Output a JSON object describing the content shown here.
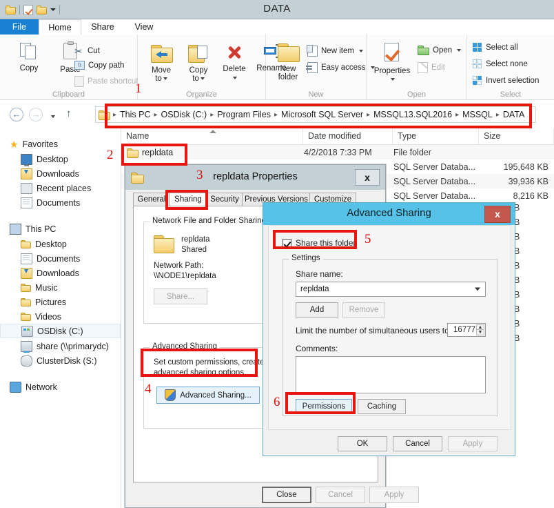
{
  "window": {
    "title": "DATA",
    "quick_access": [
      "folder-icon",
      "properties-icon",
      "folder-icon",
      "dropdown-caret"
    ]
  },
  "ribbon": {
    "tabs": [
      {
        "label": "File",
        "selected": false,
        "is_file": true
      },
      {
        "label": "Home",
        "selected": true,
        "is_file": false
      },
      {
        "label": "Share",
        "selected": false,
        "is_file": false
      },
      {
        "label": "View",
        "selected": false,
        "is_file": false
      }
    ],
    "groups": [
      {
        "name": "Clipboard",
        "big_buttons": [
          {
            "label": "Copy"
          },
          {
            "label": "Paste"
          }
        ],
        "small_buttons": [
          {
            "label": "Cut",
            "disabled": false
          },
          {
            "label": "Copy path",
            "disabled": false
          },
          {
            "label": "Paste shortcut",
            "disabled": true
          }
        ]
      },
      {
        "name": "Organize",
        "big_buttons": [
          {
            "label": "Move\nto"
          },
          {
            "label": "Copy\nto"
          },
          {
            "label": "Delete"
          },
          {
            "label": "Rename"
          }
        ],
        "small_buttons": []
      },
      {
        "name": "New",
        "big_buttons": [
          {
            "label": "New\nfolder"
          }
        ],
        "small_buttons": [
          {
            "label": "New item",
            "disabled": false
          },
          {
            "label": "Easy access",
            "disabled": false
          }
        ]
      },
      {
        "name": "Open",
        "big_buttons": [
          {
            "label": "Properties"
          }
        ],
        "small_buttons": [
          {
            "label": "Open",
            "disabled": false
          },
          {
            "label": "Edit",
            "disabled": true
          }
        ]
      },
      {
        "name": "Select",
        "big_buttons": [],
        "small_buttons": [
          {
            "label": "Select all",
            "disabled": false
          },
          {
            "label": "Select none",
            "disabled": false
          },
          {
            "label": "Invert selection",
            "disabled": false
          }
        ]
      }
    ],
    "labels": {
      "move_to": "Move",
      "move_to2": "to",
      "copy_to": "Copy",
      "copy_to2": "to",
      "delete": "Delete",
      "rename": "Rename",
      "new_folder1": "New",
      "new_folder2": "folder",
      "properties": "Properties",
      "copy": "Copy",
      "paste": "Paste"
    }
  },
  "address_bar": {
    "back_icon": "back-arrow-icon",
    "forward_icon": "forward-arrow-icon",
    "history_icon": "dropdown-caret-icon",
    "up_icon": "up-arrow-icon",
    "breadcrumbs": [
      "This PC",
      "OSDisk (C:)",
      "Program Files",
      "Microsoft SQL Server",
      "MSSQL13.SQL2016",
      "MSSQL",
      "DATA"
    ],
    "separator": "▸"
  },
  "nav_pane": {
    "sections": [
      {
        "header": {
          "label": "Favorites",
          "icon": "star-icon"
        },
        "items": [
          {
            "label": "Desktop",
            "icon": "monitor-icon"
          },
          {
            "label": "Downloads",
            "icon": "downloads-folder-icon"
          },
          {
            "label": "Recent places",
            "icon": "recent-places-icon"
          },
          {
            "label": "Documents",
            "icon": "documents-icon"
          }
        ]
      },
      {
        "header": {
          "label": "This PC",
          "icon": "computer-icon"
        },
        "items": [
          {
            "label": "Desktop",
            "icon": "desktop-folder-icon"
          },
          {
            "label": "Documents",
            "icon": "documents-icon"
          },
          {
            "label": "Downloads",
            "icon": "downloads-folder-icon"
          },
          {
            "label": "Music",
            "icon": "music-folder-icon"
          },
          {
            "label": "Pictures",
            "icon": "pictures-folder-icon"
          },
          {
            "label": "Videos",
            "icon": "videos-folder-icon"
          },
          {
            "label": "OSDisk (C:)",
            "icon": "hard-drive-icon",
            "selected": true
          },
          {
            "label": "share (\\\\primarydc)",
            "icon": "network-drive-icon"
          },
          {
            "label": "ClusterDisk (S:)",
            "icon": "disk-icon"
          }
        ]
      },
      {
        "header": {
          "label": "Network",
          "icon": "network-icon"
        },
        "items": []
      }
    ]
  },
  "file_list": {
    "columns": [
      {
        "label": "Name",
        "sorted": "asc"
      },
      {
        "label": "Date modified"
      },
      {
        "label": "Type"
      },
      {
        "label": "Size"
      }
    ],
    "rows": [
      {
        "name": "repldata",
        "icon": "folder-icon",
        "date": "4/2/2018 7:33 PM",
        "type": "File folder",
        "size": ""
      },
      {
        "name": "",
        "icon": "folder-icon",
        "date": "",
        "type": "SQL Server Databa...",
        "size": "195,648 KB"
      },
      {
        "name": "",
        "icon": "",
        "date": "",
        "type": "SQL Server Databa...",
        "size": "39,936 KB"
      },
      {
        "name": "",
        "icon": "",
        "date": "",
        "type": "SQL Server Databa...",
        "size": "8,216 KB"
      }
    ],
    "occluded_size_suffix": "B"
  },
  "properties_dialog": {
    "title": "repldata Properties",
    "close_label": "x",
    "tabs": [
      {
        "label": "General",
        "selected": false
      },
      {
        "label": "Sharing",
        "selected": true
      },
      {
        "label": "Security",
        "selected": false
      },
      {
        "label": "Previous Versions",
        "selected": false
      },
      {
        "label": "Customize",
        "selected": false
      }
    ],
    "network_group": {
      "legend": "Network File and Folder Sharing",
      "folder_name": "repldata",
      "folder_status": "Shared",
      "path_label": "Network Path:",
      "path_value": "\\\\NODE1\\repldata",
      "share_button": "Share..."
    },
    "advanced_group": {
      "legend": "Advanced Sharing",
      "description_line1": "Set custom permissions, create mu",
      "description_line2": "advanced sharing options.",
      "button": "Advanced Sharing..."
    },
    "footer_buttons": [
      {
        "label": "Close",
        "disabled": false,
        "default": true
      },
      {
        "label": "Cancel",
        "disabled": true,
        "default": false
      },
      {
        "label": "Apply",
        "disabled": true,
        "default": false
      }
    ]
  },
  "advanced_sharing_dialog": {
    "title": "Advanced Sharing",
    "close_label": "x",
    "share_checkbox": {
      "label": "Share this folder",
      "checked": true
    },
    "settings_group": {
      "legend": "Settings",
      "share_name_label": "Share name:",
      "share_name_value": "repldata",
      "add_button": "Add",
      "remove_button": "Remove",
      "limit_label": "Limit the number of simultaneous users to:",
      "limit_value": "16777",
      "comments_label": "Comments:",
      "comments_value": "",
      "permissions_button": "Permissions",
      "caching_button": "Caching"
    },
    "footer_buttons": [
      {
        "label": "OK",
        "disabled": false
      },
      {
        "label": "Cancel",
        "disabled": false
      },
      {
        "label": "Apply",
        "disabled": true
      }
    ]
  },
  "annotations": {
    "color": "#e8150f",
    "numbers": [
      {
        "value": "1",
        "target": "address-bar"
      },
      {
        "value": "2",
        "target": "repldata-row"
      },
      {
        "value": "3",
        "target": "properties-dialog-title"
      },
      {
        "value": "4",
        "target": "advanced-sharing-button"
      },
      {
        "value": "5",
        "target": "share-this-folder-checkbox"
      },
      {
        "value": "6",
        "target": "permissions-button"
      }
    ]
  }
}
